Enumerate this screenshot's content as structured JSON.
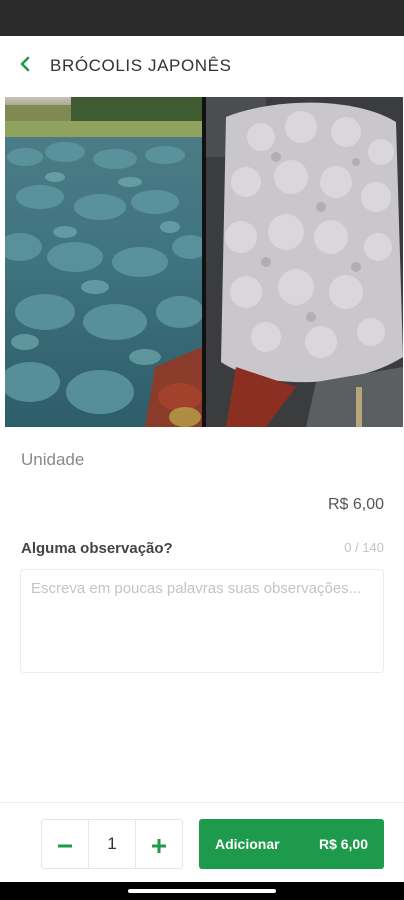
{
  "header": {
    "title": "BRÓCOLIS JAPONÊS",
    "back_icon": "chevron-left-icon"
  },
  "product": {
    "unit": "Unidade",
    "price": "R$ 6,00"
  },
  "observation": {
    "label": "Alguma observação?",
    "counter": "0 / 140",
    "placeholder": "Escreva em poucas palavras suas observações...",
    "value": ""
  },
  "cart": {
    "decrement_icon": "minus-icon",
    "quantity": "1",
    "increment_icon": "plus-icon",
    "add_label": "Adicionar",
    "add_price": "R$ 6,00"
  },
  "colors": {
    "accent": "#1e9a4c",
    "status_bar": "#2b2b2b"
  }
}
